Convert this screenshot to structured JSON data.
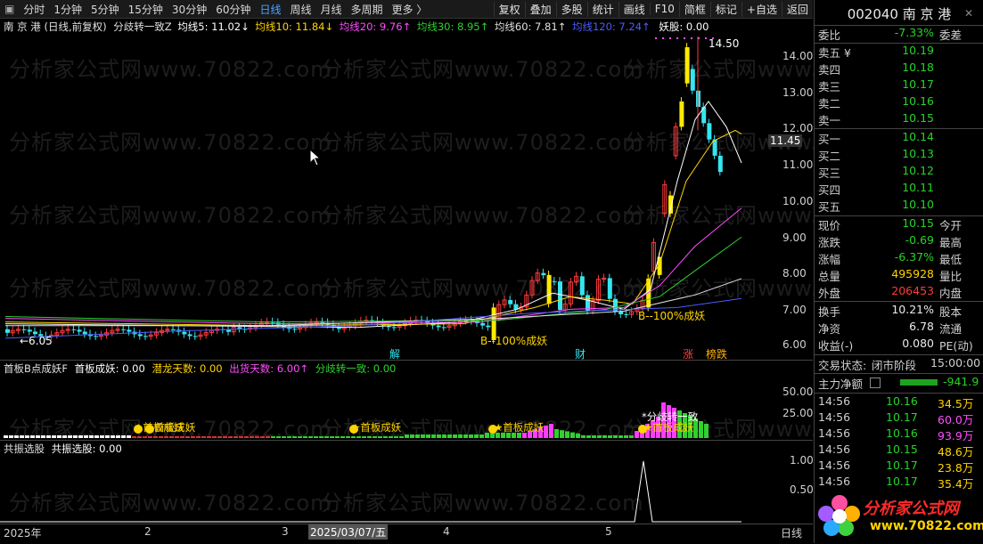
{
  "toolbar": {
    "items": [
      "分时",
      "1分钟",
      "5分钟",
      "15分钟",
      "30分钟",
      "60分钟",
      "日线",
      "周线",
      "月线",
      "多周期",
      "更多 〉"
    ],
    "active_index": 6,
    "right_buttons": [
      "复权",
      "叠加",
      "多股",
      "统计",
      "画线",
      "F10",
      "简框",
      "标记",
      "+自选",
      "返回"
    ]
  },
  "main_legend": {
    "name": "南 京 港 (日线,前复权)",
    "indicator": "分歧转一致Z",
    "ma5": "均线5: 11.02↓",
    "ma10": "均线10: 11.84↓",
    "ma20": "均线20: 9.76↑",
    "ma30": "均线30: 8.95↑",
    "ma60": "均线60: 7.81↑",
    "ma120": "均线120: 7.24↑",
    "yao": "妖股: 0.00"
  },
  "colors": {
    "ma5": "#ffffff",
    "ma10": "#ffd400",
    "ma20": "#ff4dff",
    "ma30": "#2fd12f",
    "ma60": "#e0e0e0",
    "ma120": "#4b5cff",
    "up": "#ff3b3b",
    "down": "#35e6f0"
  },
  "price_axis": {
    "ticks": [
      "14.00",
      "13.00",
      "12.00",
      "11.00",
      "10.00",
      "9.00",
      "8.00",
      "7.00",
      "6.00"
    ],
    "current": "11.45"
  },
  "annotations": {
    "high": "14.50",
    "low": "←6.05",
    "pct1": "B--100%成妖",
    "pct2": "B--100%成妖",
    "jie": "解",
    "cai": "财",
    "zhang": "涨",
    "bangdie": "榜跌"
  },
  "sub1": {
    "legend_name": "首板B点成妖F",
    "a": "首板成妖: 0.00",
    "b": "潜龙天数: 0.00",
    "c": "出货天数: 6.00↑",
    "d": "分歧转一致: 0.00",
    "axis": [
      "50.00",
      "25.00"
    ],
    "labels": [
      "★首板成妖",
      "★首板成妖",
      "★首板成妖",
      "*分歧转一致",
      "★首板成妖"
    ]
  },
  "sub2": {
    "legend_name": "共振选股",
    "a": "共振选股: 0.00",
    "axis": [
      "1.00",
      "0.50"
    ]
  },
  "date_axis": [
    "2025年",
    "2",
    "3",
    "2025/03/07/五",
    "4",
    "5",
    "日线"
  ],
  "watermark": "分析家公式网www.70822.com",
  "quote": {
    "code_name": "002040 南 京 港",
    "webi": {
      "label": "委比",
      "value": "-7.33%",
      "label2": "委差"
    },
    "asks": [
      {
        "label": "卖五 ¥",
        "price": "10.19"
      },
      {
        "label": "卖四",
        "price": "10.18"
      },
      {
        "label": "卖三",
        "price": "10.17"
      },
      {
        "label": "卖二",
        "price": "10.16"
      },
      {
        "label": "卖一",
        "price": "10.15"
      }
    ],
    "bids": [
      {
        "label": "买一",
        "price": "10.14"
      },
      {
        "label": "买二",
        "price": "10.13"
      },
      {
        "label": "买三",
        "price": "10.12"
      },
      {
        "label": "买四",
        "price": "10.11"
      },
      {
        "label": "买五",
        "price": "10.10"
      }
    ],
    "stats": [
      {
        "label": "现价",
        "value": "10.15",
        "label2": "今开"
      },
      {
        "label": "涨跌",
        "value": "-0.69",
        "label2": "最高"
      },
      {
        "label": "涨幅",
        "value": "-6.37%",
        "label2": "最低"
      },
      {
        "label": "总量",
        "value": "495928",
        "label2": "量比"
      },
      {
        "label": "外盘",
        "value": "206453",
        "label2": "内盘"
      }
    ],
    "stats2": [
      {
        "label": "换手",
        "value": "10.21%",
        "label2": "股本"
      },
      {
        "label": "净资",
        "value": "6.78",
        "label2": "流通"
      },
      {
        "label": "收益(-)",
        "value": "0.080",
        "label2": "PE(动)"
      }
    ],
    "trade_status": {
      "label": "交易状态:",
      "value": "闭市阶段",
      "time": "15:00:00"
    },
    "main_flow": {
      "label": "主力净额",
      "value": "-941.9"
    },
    "ticks": [
      {
        "time": "14:56",
        "price": "10.16",
        "vol": "34.5万"
      },
      {
        "time": "14:56",
        "price": "10.17",
        "vol": "60.0万"
      },
      {
        "time": "14:56",
        "price": "10.16",
        "vol": "93.9万"
      },
      {
        "time": "14:56",
        "price": "10.15",
        "vol": "48.6万"
      },
      {
        "time": "14:56",
        "price": "10.17",
        "vol": "23.8万"
      },
      {
        "time": "14:56",
        "price": "10.17",
        "vol": "35.4万"
      }
    ],
    "logo_text": "分析家公式网",
    "logo_url": "www.70822.com"
  }
}
